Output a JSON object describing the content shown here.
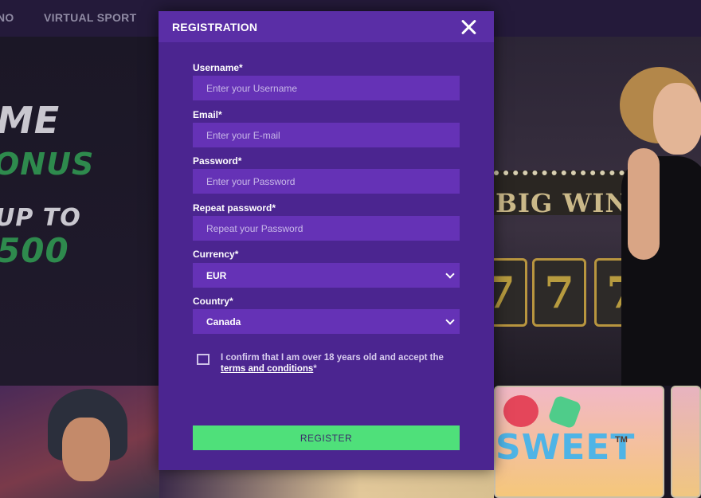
{
  "nav": {
    "items": [
      {
        "label": "NO"
      },
      {
        "label": "VIRTUAL SPORT"
      }
    ]
  },
  "promo": {
    "line1": "ME",
    "line2": "ONUS",
    "line3": "UP TO",
    "line4": "500"
  },
  "hero": {
    "sign_text": "BIG WIN",
    "reels": [
      "7",
      "7",
      "7"
    ]
  },
  "tiles": {
    "sweet_text": "SWEET",
    "sweet_tm": "TM"
  },
  "modal": {
    "title": "REGISTRATION",
    "fields": {
      "username": {
        "label": "Username*",
        "placeholder": "Enter your Username"
      },
      "email": {
        "label": "Email*",
        "placeholder": "Enter your E-mail"
      },
      "password": {
        "label": "Password*",
        "placeholder": "Enter your Password"
      },
      "repeat_password": {
        "label": "Repeat password*",
        "placeholder": "Repeat your Password"
      },
      "currency": {
        "label": "Currency*",
        "value": "EUR"
      },
      "country": {
        "label": "Country*",
        "value": "Canada"
      }
    },
    "confirm": {
      "text": "I confirm that I am over 18 years old and accept the",
      "link": "terms and conditions",
      "suffix": "*"
    },
    "register_label": "REGISTER"
  },
  "colors": {
    "modal_bg": "#4b2590",
    "header_bg": "#5a2ea6",
    "input_bg": "#6532b6",
    "register_bg": "#4fe07a",
    "promo_green": "#2e8a4d"
  },
  "icons": {
    "close": "close-icon",
    "currency_chevron": "chevron-down-icon",
    "country_chevron": "chevron-down-icon"
  }
}
